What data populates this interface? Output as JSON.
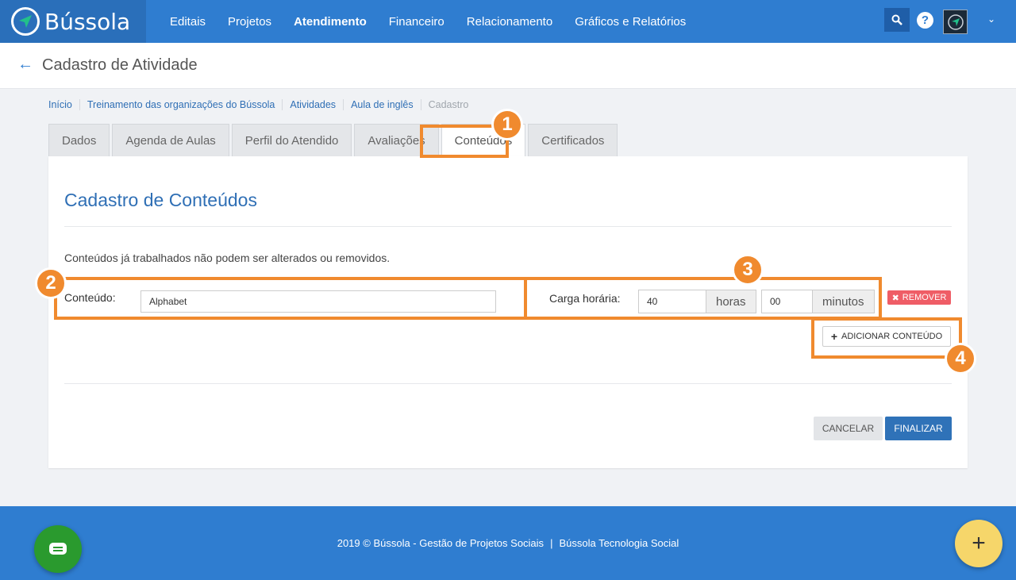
{
  "app": {
    "brand": "Bússola"
  },
  "nav": {
    "items": [
      {
        "label": "Editais"
      },
      {
        "label": "Projetos"
      },
      {
        "label": "Atendimento"
      },
      {
        "label": "Financeiro"
      },
      {
        "label": "Relacionamento"
      },
      {
        "label": "Gráficos e Relatórios"
      }
    ],
    "active_index": 2,
    "help_label": "?"
  },
  "header": {
    "back_icon": "arrow-left-icon",
    "title": "Cadastro de Atividade"
  },
  "breadcrumb": [
    {
      "label": "Início"
    },
    {
      "label": "Treinamento das organizações do Bússola"
    },
    {
      "label": "Atividades"
    },
    {
      "label": "Aula de inglês"
    },
    {
      "label": "Cadastro"
    }
  ],
  "tabs": [
    {
      "label": "Dados"
    },
    {
      "label": "Agenda de Aulas"
    },
    {
      "label": "Perfil do Atendido"
    },
    {
      "label": "Avaliações"
    },
    {
      "label": "Conteúdos"
    },
    {
      "label": "Certificados"
    }
  ],
  "active_tab": "Conteúdos",
  "form": {
    "title": "Cadastro de Conteúdos",
    "notice": "Conteúdos já trabalhados não podem ser alterados ou removidos.",
    "content_label": "Conteúdo:",
    "content_value": "Alphabet",
    "workload_label": "Carga horária:",
    "hours_value": "40",
    "hours_addon": "horas",
    "minutes_value": "00",
    "minutes_addon": "minutos",
    "remove_label": "REMOVER",
    "add_label": "ADICIONAR CONTEÚDO",
    "cancel_label": "CANCELAR",
    "finish_label": "FINALIZAR"
  },
  "annotations": [
    "1",
    "2",
    "3",
    "4"
  ],
  "footer": {
    "copyright": "2019 © Bússola - Gestão de Projetos Sociais",
    "separator": "|",
    "company": "Bússola Tecnologia Social"
  },
  "colors": {
    "primary": "#2f7dd0",
    "annotation": "#f08a2e",
    "remove": "#ef5d66",
    "chat": "#2a9a2e",
    "fab": "#f6d66a"
  }
}
